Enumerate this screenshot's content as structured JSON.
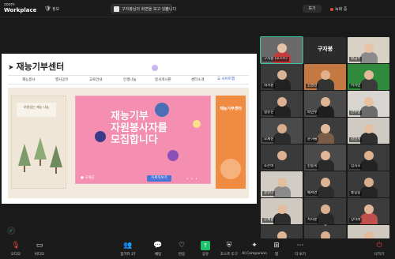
{
  "app": {
    "brand_top": "zoom",
    "brand_name": "Workplace"
  },
  "topbar": {
    "shield_icon": "shield-icon",
    "info_label": "정보",
    "share_banner": "구자봉님의 화면을 보고 있습니다",
    "share_close": "×",
    "view_label": "보기",
    "recording_label": "녹화 중",
    "recording_color": "#e5463b"
  },
  "shared": {
    "site_title": "재능기부센터",
    "arrow": "➤",
    "nav": [
      "재능봉사",
      "행사공유",
      "교육안내",
      "인생나눔",
      "봉사게시판",
      "센터소개"
    ],
    "site_map": "사이트맵",
    "left_card_label": "보람있는 재능\n나눔",
    "main_title": "재능기부\n자원봉사자를\n모집합니다",
    "main_logo": "● 구세군",
    "more_button": "자세히보기",
    "dots": "• • •",
    "right_card_title": "재능기부센터",
    "main_bg": "#f48fb1",
    "right_bg": "#f08b42"
  },
  "participants": [
    {
      "name": "구자봉 (호스트)",
      "bg": "#6a6a6a",
      "skin": "#e7c2a6",
      "shirt": "#c43c3c",
      "active": true
    },
    {
      "name": "구자봉",
      "bg": "#2b2b2b",
      "nameonly": true
    },
    {
      "name": "황금주",
      "bg": "#d9d1c4",
      "skin": "#e8c3a6",
      "shirt": "#8b8b8b"
    },
    {
      "name": "최지원",
      "bg": "#3a3a3a",
      "skin": "#d9b395",
      "shirt": "#222"
    },
    {
      "name": "김성현",
      "bg": "#c47842",
      "skin": "#e0b08c",
      "shirt": "#333"
    },
    {
      "name": "이지민",
      "bg": "#2f8a3b",
      "skin": "#e2b99a",
      "shirt": "#3b3b3b"
    },
    {
      "name": "정유진",
      "bg": "#3d3d3d",
      "skin": "#dcb090",
      "shirt": "#222"
    },
    {
      "name": "박민수",
      "bg": "#4a4a4a",
      "skin": "#e0b594",
      "shirt": "#1f1f1f"
    },
    {
      "name": "한수영",
      "bg": "#d8d4cf",
      "skin": "#e6c1a2",
      "shirt": "#6b6b6b"
    },
    {
      "name": "오세진",
      "bg": "#4a4a4a",
      "skin": "#d8ad8d",
      "shirt": "#2c2c2c"
    },
    {
      "name": "윤하늘",
      "bg": "#3c3c3c",
      "skin": "#e3bb9c",
      "shirt": "#7a5c48"
    },
    {
      "name": "강민지",
      "bg": "#cfcac2",
      "skin": "#e5bfa0",
      "shirt": "#2f2f2f"
    },
    {
      "name": "조은비",
      "bg": "#3a3a3a",
      "skin": "#dcb192",
      "shirt": "#3a3a3a"
    },
    {
      "name": "신동욱",
      "bg": "#4a4a4a",
      "skin": "#e1b797",
      "shirt": "#2a2a2a"
    },
    {
      "name": "임지호",
      "bg": "#3b3b3b",
      "skin": "#dbb190",
      "shirt": "#232323"
    },
    {
      "name": "송유나",
      "bg": "#d1ccc4",
      "skin": "#e4bf9f",
      "shirt": "#8a8a8a"
    },
    {
      "name": "배서연",
      "bg": "#3c3c3c",
      "skin": "#ddb393",
      "shirt": "#2c2c2c"
    },
    {
      "name": "홍길동",
      "bg": "#3a3a3a",
      "skin": "#d8ae8e",
      "shirt": "#252525"
    },
    {
      "name": "문채원",
      "bg": "#cfc9c0",
      "skin": "#e3bd9d",
      "shirt": "#2e2e2e"
    },
    {
      "name": "서지훈",
      "bg": "#3a3a3a",
      "skin": "#dab090",
      "shirt": "#272727"
    },
    {
      "name": "장미래",
      "bg": "#3c3c3c",
      "skin": "#e0b796",
      "shirt": "#c0504d"
    },
    {
      "name": "권나래",
      "bg": "#3a3a3a",
      "skin": "#ddb494",
      "shirt": "#2a2a2a"
    },
    {
      "name": "유승호",
      "bg": "#3b3b3b",
      "skin": "#d9af8f",
      "shirt": "#2b2b2b"
    },
    {
      "name": "노은정",
      "bg": "#cfc9c0",
      "skin": "#e2bc9c",
      "shirt": "#333"
    }
  ],
  "toolbar": {
    "audio": "오디오",
    "video": "비디오",
    "participants": "참가자",
    "participant_count": "27",
    "chat": "채팅",
    "react": "반응",
    "share": "공유",
    "host_tools": "호스트 도구",
    "ai_companion": "AI Companion",
    "apps": "앱",
    "more": "더 보기",
    "leave": "나가기"
  }
}
